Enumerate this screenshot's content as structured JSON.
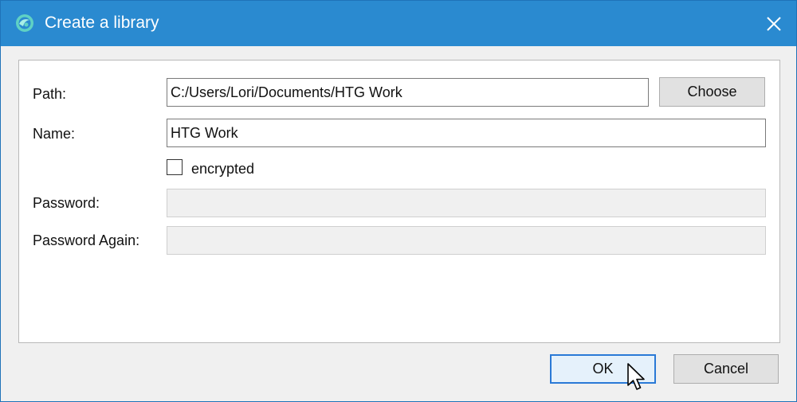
{
  "window": {
    "title": "Create a library"
  },
  "form": {
    "path_label": "Path:",
    "path_value": "C:/Users/Lori/Documents/HTG Work",
    "choose_label": "Choose",
    "name_label": "Name:",
    "name_value": "HTG Work",
    "encrypted_label": "encrypted",
    "encrypted_checked": false,
    "password_label": "Password:",
    "password_again_label": "Password Again:"
  },
  "footer": {
    "ok_label": "OK",
    "cancel_label": "Cancel"
  },
  "colors": {
    "titlebar": "#2a8ad0",
    "accent_border": "#2a79d6",
    "app_icon": "#5fd1c4"
  },
  "icons": {
    "app": "seafile-logo-icon",
    "close": "close-icon",
    "cursor": "mouse-pointer-icon"
  }
}
